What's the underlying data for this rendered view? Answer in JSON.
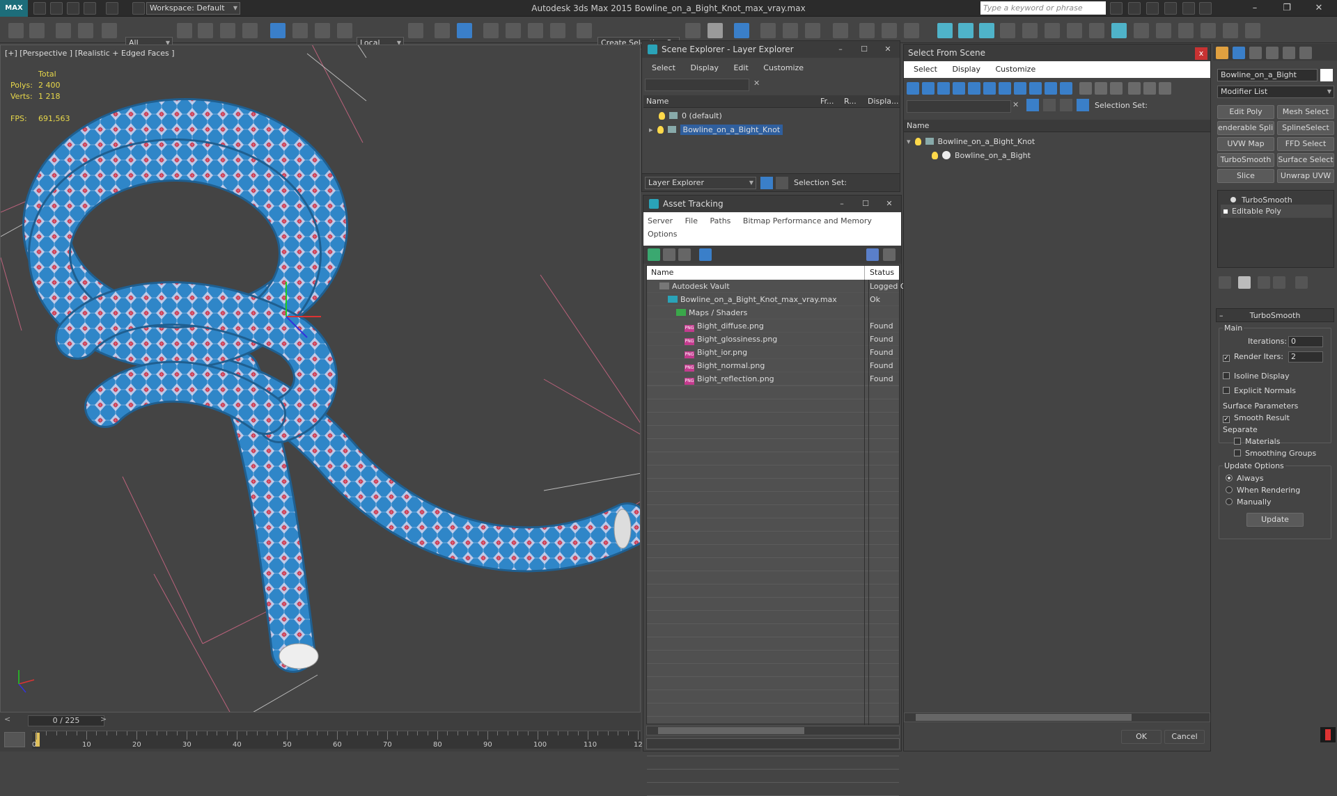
{
  "app": {
    "logo": "MAX",
    "workspace": "Workspace: Default",
    "title": "Autodesk 3ds Max  2015      Bowline_on_a_Bight_Knot_max_vray.max",
    "search_placeholder": "Type a keyword or phrase"
  },
  "toolbar": {
    "filter_value": "All",
    "coord_value": "Local",
    "selection_set_placeholder": "Create Selection Se"
  },
  "viewport": {
    "label": "[+] [Perspective ] [Realistic + Edged Faces ]",
    "stats": {
      "total_label": "Total",
      "polys_label": "Polys:",
      "polys_value": "2 400",
      "verts_label": "Verts:",
      "verts_value": "1 218",
      "fps_label": "FPS:",
      "fps_value": "691,563"
    }
  },
  "timeline": {
    "frame_display": "0 / 225",
    "prev": "<",
    "next": ">",
    "ticks": [
      "0",
      "10",
      "20",
      "30",
      "40",
      "50",
      "60",
      "70",
      "80",
      "90",
      "100",
      "110",
      "12"
    ]
  },
  "scene_explorer": {
    "title": "Scene Explorer - Layer Explorer",
    "menu": [
      "Select",
      "Display",
      "Edit",
      "Customize"
    ],
    "columns": {
      "name": "Name",
      "frozen": "Fr...",
      "render": "R...",
      "display": "Displa..."
    },
    "rows": [
      {
        "label": "0 (default)"
      },
      {
        "label": "Bowline_on_a_Bight_Knot"
      }
    ],
    "footer_explorer": "Layer Explorer",
    "footer_selset": "Selection Set:"
  },
  "asset_tracking": {
    "title": "Asset Tracking",
    "menu_line1": [
      "Server",
      "File",
      "Paths",
      "Bitmap Performance and Memory"
    ],
    "menu_line2": [
      "Options"
    ],
    "columns": {
      "name": "Name",
      "status": "Status"
    },
    "rows": [
      {
        "name": "Autodesk Vault",
        "status": "Logged Out",
        "indent": 1
      },
      {
        "name": "Bowline_on_a_Bight_Knot_max_vray.max",
        "status": "Ok",
        "indent": 2
      },
      {
        "name": "Maps / Shaders",
        "status": "",
        "indent": 3
      },
      {
        "name": "Bight_diffuse.png",
        "status": "Found",
        "indent": 4
      },
      {
        "name": "Bight_glossiness.png",
        "status": "Found",
        "indent": 4
      },
      {
        "name": "Bight_ior.png",
        "status": "Found",
        "indent": 4
      },
      {
        "name": "Bight_normal.png",
        "status": "Found",
        "indent": 4
      },
      {
        "name": "Bight_reflection.png",
        "status": "Found",
        "indent": 4
      }
    ]
  },
  "select_from_scene": {
    "title": "Select From Scene",
    "close": "x",
    "menu": [
      "Select",
      "Display",
      "Customize"
    ],
    "selection_set": "Selection Set:",
    "column_name": "Name",
    "rows": [
      {
        "label": "Bowline_on_a_Bight_Knot"
      },
      {
        "label": "Bowline_on_a_Bight"
      }
    ],
    "ok": "OK",
    "cancel": "Cancel"
  },
  "command_panel": {
    "object_name": "Bowline_on_a_Bight",
    "modifier_list": "Modifier List",
    "modifier_buttons": [
      "Edit Poly",
      "Mesh Select",
      "enderable Splin",
      "SplineSelect",
      "UVW Map",
      "FFD Select",
      "TurboSmooth",
      "Surface Select",
      "Slice",
      "Unwrap UVW"
    ],
    "stack": [
      "TurboSmooth",
      "Editable Poly"
    ],
    "rollout_title": "TurboSmooth",
    "main_label": "Main",
    "iterations_label": "Iterations:",
    "iterations_value": "0",
    "render_iters_label": "Render Iters:",
    "render_iters_value": "2",
    "isoline_label": "Isoline Display",
    "explicit_label": "Explicit Normals",
    "surface_params_label": "Surface Parameters",
    "smooth_result_label": "Smooth Result",
    "separate_label": "Separate",
    "materials_label": "Materials",
    "smoothing_groups_label": "Smoothing Groups",
    "update_options_label": "Update Options",
    "always_label": "Always",
    "when_rendering_label": "When Rendering",
    "manually_label": "Manually",
    "update_button": "Update"
  }
}
